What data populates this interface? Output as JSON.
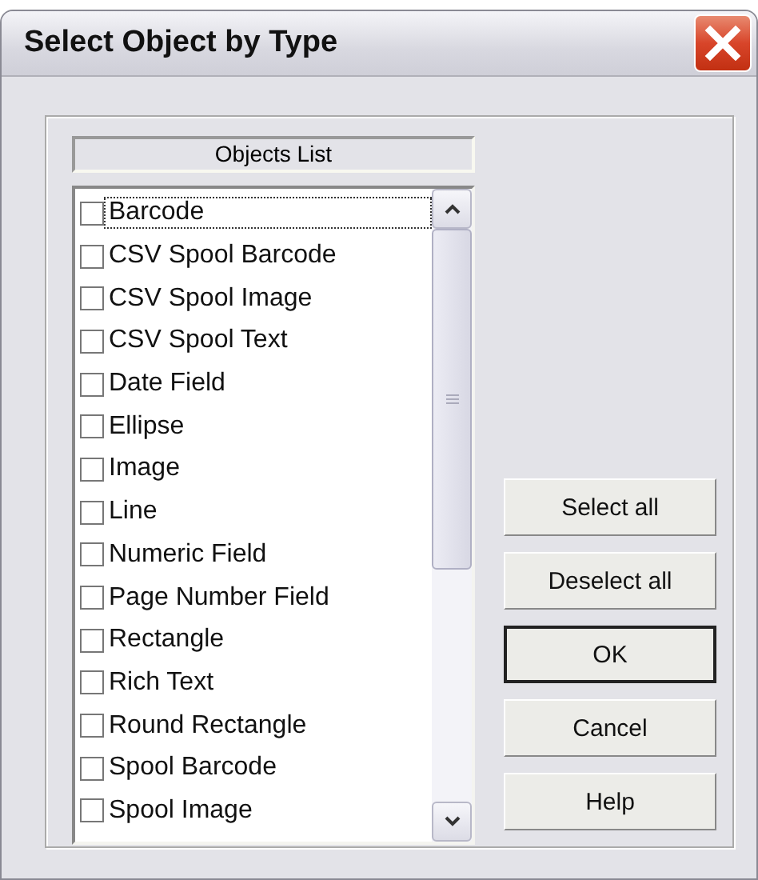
{
  "window": {
    "title": "Select Object by Type"
  },
  "list_header": "Objects List",
  "items": [
    {
      "label": "Barcode",
      "checked": false,
      "focused": true
    },
    {
      "label": "CSV Spool Barcode",
      "checked": false,
      "focused": false
    },
    {
      "label": "CSV Spool Image",
      "checked": false,
      "focused": false
    },
    {
      "label": "CSV Spool Text",
      "checked": false,
      "focused": false
    },
    {
      "label": "Date Field",
      "checked": false,
      "focused": false
    },
    {
      "label": "Ellipse",
      "checked": false,
      "focused": false
    },
    {
      "label": "Image",
      "checked": false,
      "focused": false
    },
    {
      "label": "Line",
      "checked": false,
      "focused": false
    },
    {
      "label": "Numeric Field",
      "checked": false,
      "focused": false
    },
    {
      "label": "Page Number Field",
      "checked": false,
      "focused": false
    },
    {
      "label": "Rectangle",
      "checked": false,
      "focused": false
    },
    {
      "label": "Rich Text",
      "checked": false,
      "focused": false
    },
    {
      "label": "Round Rectangle",
      "checked": false,
      "focused": false
    },
    {
      "label": "Spool Barcode",
      "checked": false,
      "focused": false
    },
    {
      "label": "Spool Image",
      "checked": false,
      "focused": false
    }
  ],
  "buttons": [
    {
      "label": "Select all",
      "default": false
    },
    {
      "label": "Deselect all",
      "default": false
    },
    {
      "label": "OK",
      "default": true
    },
    {
      "label": "Cancel",
      "default": false
    },
    {
      "label": "Help",
      "default": false
    }
  ]
}
